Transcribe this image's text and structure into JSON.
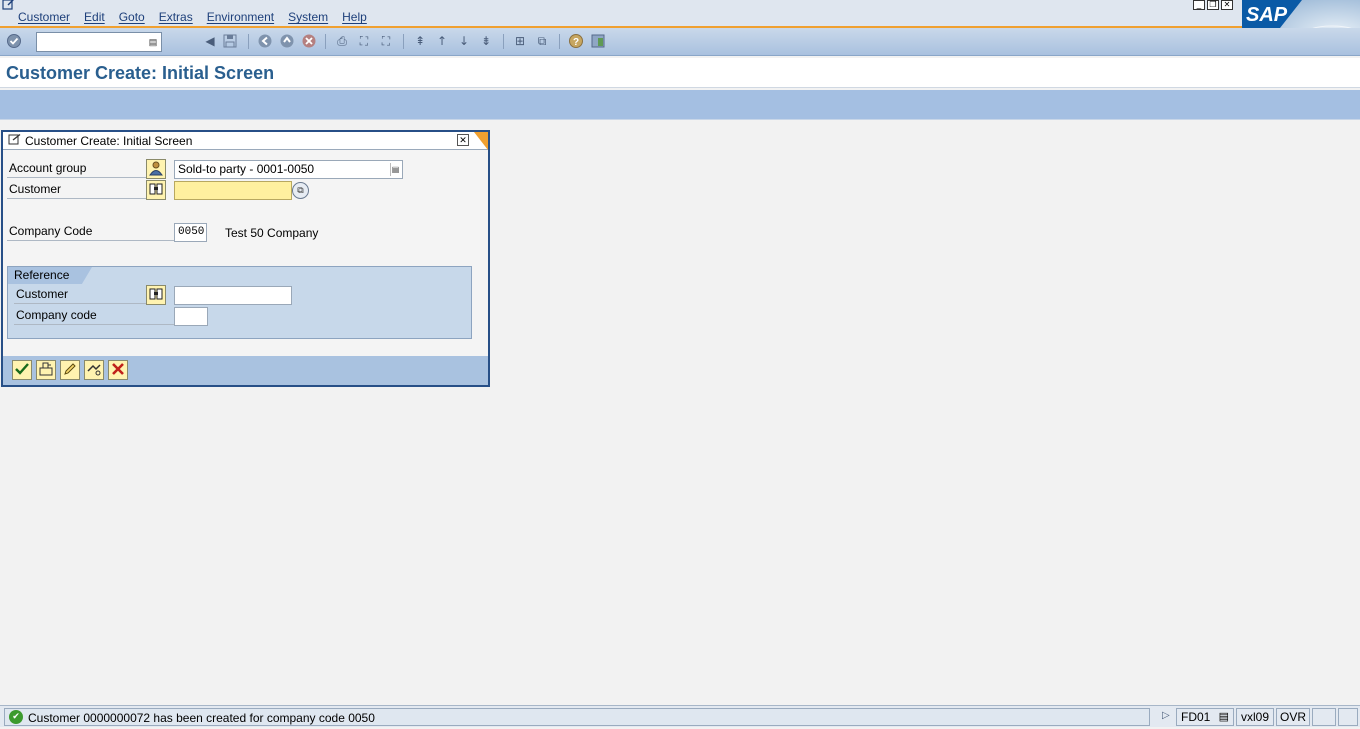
{
  "menu": {
    "items": [
      "Customer",
      "Edit",
      "Goto",
      "Extras",
      "Environment",
      "System",
      "Help"
    ]
  },
  "brand": {
    "logo_text": "SAP",
    "color": "#0a5aa6"
  },
  "toolbar": {
    "command_field_value": ""
  },
  "page": {
    "title": "Customer Create: Initial Screen"
  },
  "dialog": {
    "title": "Customer Create: Initial Screen",
    "fields": {
      "account_group_label": "Account group",
      "account_group_value": "Sold-to party - 0001-0050",
      "customer_label": "Customer",
      "customer_value": "",
      "company_code_label": "Company Code",
      "company_code_value": "0050",
      "company_name": "Test 50 Company"
    },
    "reference": {
      "title": "Reference",
      "customer_label": "Customer",
      "customer_value": "",
      "company_code_label": "Company code",
      "company_code_value": ""
    }
  },
  "statusbar": {
    "message": "Customer 0000000072 has been created for company code 0050",
    "transaction": "FD01",
    "server": "vxl09",
    "mode": "OVR"
  },
  "colors": {
    "accent": "#f0a030",
    "title": "#2a5f8f",
    "appbar": "#a4bfe2",
    "required_field": "#fff09f",
    "success": "#3c9a2e"
  }
}
